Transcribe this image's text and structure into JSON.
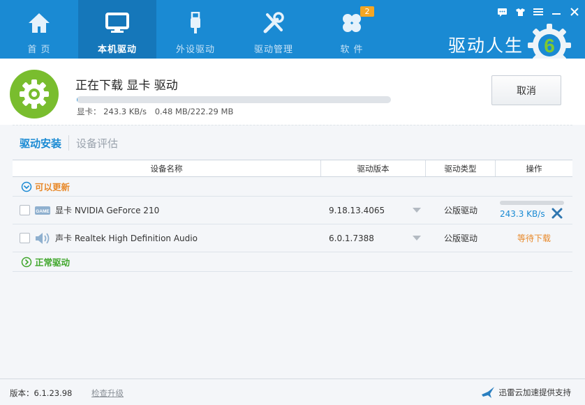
{
  "nav": {
    "items": [
      {
        "label": "首 页",
        "icon": "home-icon"
      },
      {
        "label": "本机驱动",
        "icon": "monitor-icon",
        "active": true
      },
      {
        "label": "外设驱动",
        "icon": "usb-icon"
      },
      {
        "label": "驱动管理",
        "icon": "tools-icon"
      },
      {
        "label": "软 件",
        "icon": "apps-icon"
      }
    ],
    "software_badge": "2"
  },
  "brand": {
    "name": "驱动人生",
    "logo_number": "6"
  },
  "window_controls": [
    "feedback-icon",
    "skin-icon",
    "menu-icon",
    "minimize-icon",
    "close-icon"
  ],
  "download": {
    "title": "正在下载 显卡 驱动",
    "progress_fraction": 0.002,
    "speed_label": "显卡：",
    "speed": "243.3 KB/s",
    "size": "0.48 MB/222.29 MB",
    "cancel_label": "取消"
  },
  "tabs": [
    {
      "label": "驱动安装",
      "active": true
    },
    {
      "label": "设备评估",
      "active": false
    }
  ],
  "table": {
    "headers": [
      "设备名称",
      "驱动版本",
      "驱动类型",
      "操作"
    ],
    "group_update": "可以更新",
    "group_normal": "正常驱动",
    "rows": [
      {
        "name": "显卡 NVIDIA GeForce 210",
        "icon": "game-card-icon",
        "version": "9.18.13.4065",
        "type": "公版驱动",
        "op_speed": "243.3 KB/s",
        "op_progress": 0.0
      },
      {
        "name": "声卡 Realtek High Definition Audio",
        "icon": "speaker-icon",
        "version": "6.0.1.7388",
        "type": "公版驱动",
        "op_status": "等待下载"
      }
    ]
  },
  "footer": {
    "version": "版本：6.1.23.98",
    "check_update": "检查升级",
    "accel": "迅雷云加速提供支持"
  },
  "colors": {
    "topbar": "#1a8ad3",
    "active_nav": "#1577ba",
    "accent": "#1a8ad3",
    "green": "#79bd2e",
    "orange": "#e8892a"
  }
}
